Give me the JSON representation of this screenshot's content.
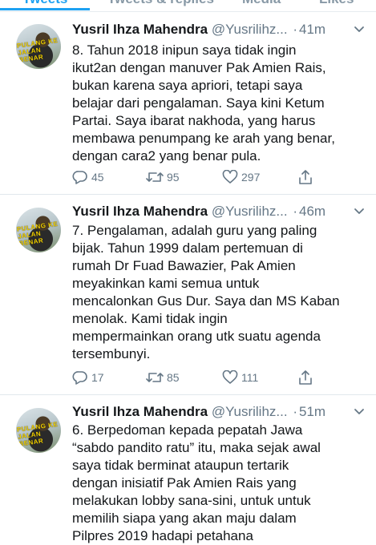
{
  "tabs": [
    {
      "label": "Tweets",
      "active": true
    },
    {
      "label": "Tweets & replies",
      "active": false
    },
    {
      "label": "Media",
      "active": false
    },
    {
      "label": "Likes",
      "active": false
    }
  ],
  "colors": {
    "accent": "#1da1f2",
    "text": "#14171a",
    "muted": "#657786",
    "divider": "#e1e8ed"
  },
  "avatar_overlay": "PULANG KE JALAN BENAR",
  "tweets": [
    {
      "name": "Yusril Ihza Mahendra",
      "handle": "@Yusrilihz...",
      "time": "41m",
      "lines": [
        "8. Tahun 2018 inipun saya tidak ingin",
        "ikut2an dengan manuver Pak Amien Rais,",
        "bukan karena saya apriori, tetapi saya",
        "belajar dari pengalaman. Saya kini Ketum",
        "Partai. Saya ibarat nakhoda, yang harus",
        "membawa penumpang ke arah yang benar,",
        "dengan cara2 yang benar pula."
      ],
      "replies": "45",
      "retweets": "95",
      "likes": "297"
    },
    {
      "name": "Yusril Ihza Mahendra",
      "handle": "@Yusrilihz...",
      "time": "46m",
      "lines": [
        "7. Pengalaman, adalah guru yang paling",
        "bijak. Tahun 1999 dalam pertemuan di",
        "rumah Dr Fuad Bawazier, Pak Amien",
        "meyakinkan kami semua untuk",
        "mencalonkan Gus Dur. Saya dan MS Kaban",
        "menolak. Kami tidak ingin",
        "mempermainkan orang utk suatu agenda",
        "tersembunyi."
      ],
      "replies": "17",
      "retweets": "85",
      "likes": "111"
    },
    {
      "name": "Yusril Ihza Mahendra",
      "handle": "@Yusrilihz...",
      "time": "51m",
      "lines": [
        "6. Berpedoman kepada pepatah Jawa",
        "“sabdo pandito ratu” itu, maka sejak awal",
        "saya tidak berminat ataupun tertarik",
        "dengan inisiatif Pak Amien Rais yang",
        "melakukan lobby sana-sini, untuk untuk",
        "memilih siapa yang akan maju dalam",
        "Pilpres 2019 hadapi petahana"
      ],
      "replies": "",
      "retweets": "",
      "likes": ""
    }
  ]
}
